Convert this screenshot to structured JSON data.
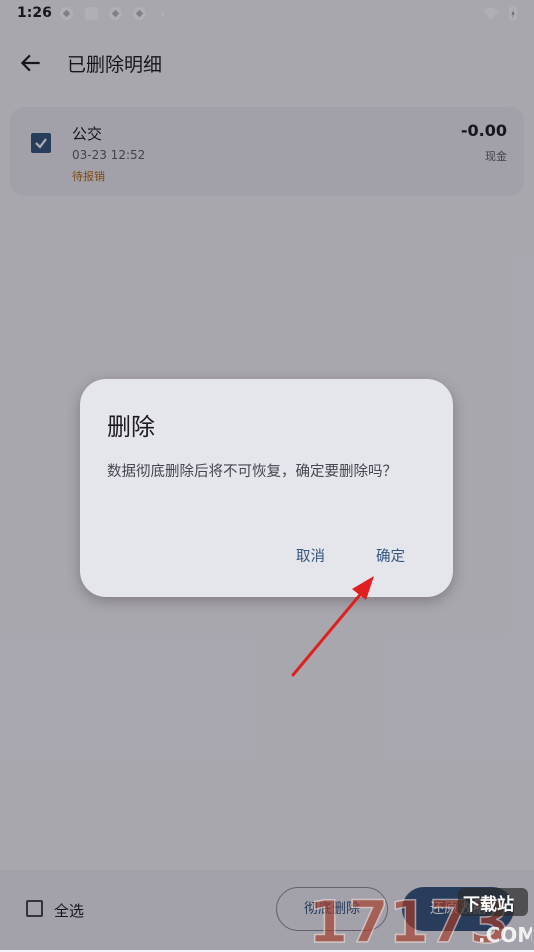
{
  "status_bar": {
    "time": "1:26"
  },
  "app_bar": {
    "title": "已删除明细"
  },
  "record": {
    "name": "公交",
    "datetime": "03-23 12:52",
    "status": "待报销",
    "amount": "-0.00",
    "account": "现金",
    "selected": true
  },
  "bottom_bar": {
    "select_all": "全选",
    "permanent_delete": "彻底删除",
    "restore": "还原数据"
  },
  "dialog": {
    "title": "删除",
    "message": "数据彻底删除后将不可恢复，确定要删除吗？",
    "cancel": "取消",
    "confirm": "确定"
  },
  "watermark": {
    "brand": "17173",
    "site": "下载站",
    "domain": ".COM"
  },
  "colors": {
    "accent": "#35557e",
    "pending": "#b4690e",
    "arrow": "#e02020"
  }
}
